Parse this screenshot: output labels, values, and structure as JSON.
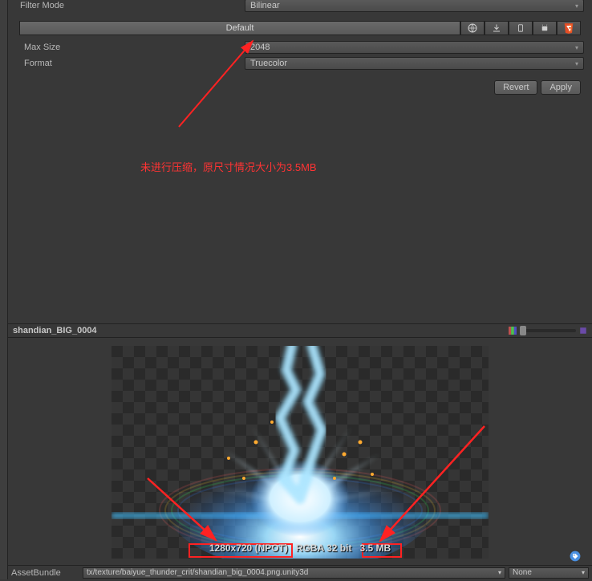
{
  "inspector": {
    "filterMode": {
      "label": "Filter Mode",
      "value": "Bilinear"
    },
    "platformTabs": {
      "default": "Default"
    },
    "maxSize": {
      "label": "Max Size",
      "value": "2048"
    },
    "format": {
      "label": "Format",
      "value": "Truecolor"
    },
    "buttons": {
      "revert": "Revert",
      "apply": "Apply"
    }
  },
  "annotation": {
    "text": "未进行压缩，原尺寸情况大小为3.5MB"
  },
  "preview": {
    "title": "shandian_BIG_0004",
    "resolution": "1280x720 (NPOT)",
    "colorFormat": "RGBA 32 bit",
    "fileSize": "3.5 MB"
  },
  "assetBundle": {
    "label": "AssetBundle",
    "path": "tx/texture/baiyue_thunder_crit/shandian_big_0004.png.unity3d",
    "variant": "None"
  }
}
